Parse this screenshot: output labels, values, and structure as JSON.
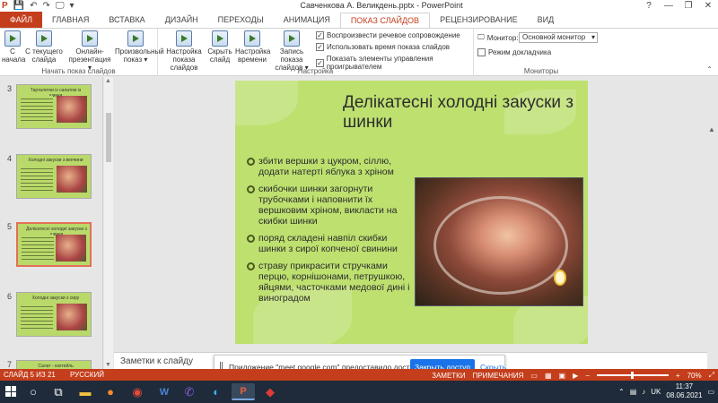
{
  "window": {
    "title": "Савченкова А. Великдень.pptx - PowerPoint",
    "help": "?",
    "minimize": "—",
    "restore": "❐",
    "close": "✕",
    "quick_access": [
      "💾",
      "↶",
      "↷",
      "🖵",
      "▾"
    ]
  },
  "tabs": [
    "ФАЙЛ",
    "ГЛАВНАЯ",
    "ВСТАВКА",
    "ДИЗАЙН",
    "ПЕРЕХОДЫ",
    "АНИМАЦИЯ",
    "ПОКАЗ СЛАЙДОВ",
    "РЕЦЕНЗИРОВАНИЕ",
    "ВИД"
  ],
  "active_tab": "ПОКАЗ СЛАЙДОВ",
  "ribbon": {
    "groups": [
      "Начать показ слайдов",
      "Настройка",
      "Мониторы"
    ],
    "buttons": {
      "from_start": "С начала",
      "from_current": "С текущего слайда",
      "online": "Онлайн-презентация ▾",
      "custom": "Произвольный показ ▾",
      "setup": "Настройка показа слайдов",
      "hide": "Скрыть слайд",
      "timings": "Настройка времени",
      "record": "Запись показа слайдов ▾"
    },
    "checkboxes": [
      {
        "label": "Воспроизвести речевое сопровождение",
        "checked": true
      },
      {
        "label": "Использовать время показа слайдов",
        "checked": true
      },
      {
        "label": "Показать элементы управления проигрывателем",
        "checked": true
      }
    ],
    "monitor_label": "Монитор:",
    "monitor_value": "Основной монитор",
    "presenter_view": {
      "label": "Режим докладчика",
      "checked": false
    }
  },
  "thumbnails": [
    {
      "num": "3",
      "title": "Тарталетки із салатом із шинки",
      "selected": false
    },
    {
      "num": "4",
      "title": "Холодні закуски з вепчини",
      "selected": false
    },
    {
      "num": "5",
      "title": "Делікатесні холодні закуски з шинки",
      "selected": true
    },
    {
      "num": "6",
      "title": "Холодні закуски з сиру",
      "selected": false
    },
    {
      "num": "7",
      "title": "Салат - коктейль",
      "selected": false
    }
  ],
  "slide": {
    "title": "Делікатесні холодні закуски з шинки",
    "bullets": [
      "збити вершки з цукром, сіллю, додати натерті яблука з хріном",
      "скибочки шинки загорнути трубочками і наповнити їх вершковим хріном, викласти на скибки шинки",
      "поряд складені навпіл скибки шинки з сирої копченої свинини",
      "страву прикрасити стручками перцю, корнішонами, петрушкою, яйцями, часточками медової дині і виноградом"
    ],
    "accent_color": "#bde06f"
  },
  "notes_placeholder": "Заметки к слайду",
  "popup": {
    "message": "Приложение \"meet.google.com\" предоставило доступ к окну.",
    "share_button": "Закрыть доступ",
    "hide_button": "Скрыть"
  },
  "status": {
    "slide_info": "СЛАЙД 5 ИЗ 21",
    "language": "РУССКИЙ",
    "notes": "ЗАМЕТКИ",
    "comments": "ПРИМЕЧАНИЯ",
    "zoom_minus": "−",
    "zoom_plus": "+",
    "zoom": "70%"
  },
  "taskbar": {
    "apps": [
      "search-icon",
      "task-view-icon",
      "explorer-icon",
      "firefox-icon",
      "chrome-icon",
      "word-icon",
      "viber-icon",
      "edge-icon",
      "powerpoint-icon",
      "acrobat-icon"
    ],
    "language": "UK",
    "time": "11:37",
    "date": "08.06.2021"
  },
  "brand_color": "#c43e1c"
}
